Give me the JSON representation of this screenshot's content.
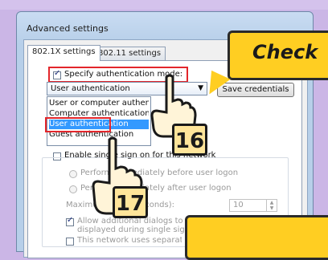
{
  "window": {
    "title": "Advanced settings"
  },
  "tabs": [
    {
      "label": "802.1X settings",
      "active": true
    },
    {
      "label": "802.11 settings",
      "active": false
    }
  ],
  "specify_auth": {
    "label": "Specify authentication mode:",
    "checked": true
  },
  "auth_select": {
    "value": "User authentication"
  },
  "save_credentials": {
    "label": "Save credentials"
  },
  "auth_options": [
    {
      "label": "User or computer authentication",
      "selected": false
    },
    {
      "label": "Computer authentication",
      "selected": false
    },
    {
      "label": "User authentication",
      "selected": true
    },
    {
      "label": "Guest authentication",
      "selected": false
    }
  ],
  "sso": {
    "enable_label": "Enable single sign on for this network",
    "radio_before": "Perform immediately before user logon",
    "radio_after": "Perform immediately after user logon",
    "max_delay_label": "Maximum delay (seconds):",
    "max_delay_value": "10",
    "allow_dialogs_label": "Allow additional dialogs to be displayed during single sign on",
    "separate_vlan_label": "This network uses separate virtual LANs for machine and user authentication"
  },
  "callout": {
    "text": "Check"
  },
  "steps": [
    "16",
    "17"
  ],
  "colors": {
    "highlight": "#e3262b",
    "callout": "#ffce22",
    "selection": "#3399ff"
  }
}
